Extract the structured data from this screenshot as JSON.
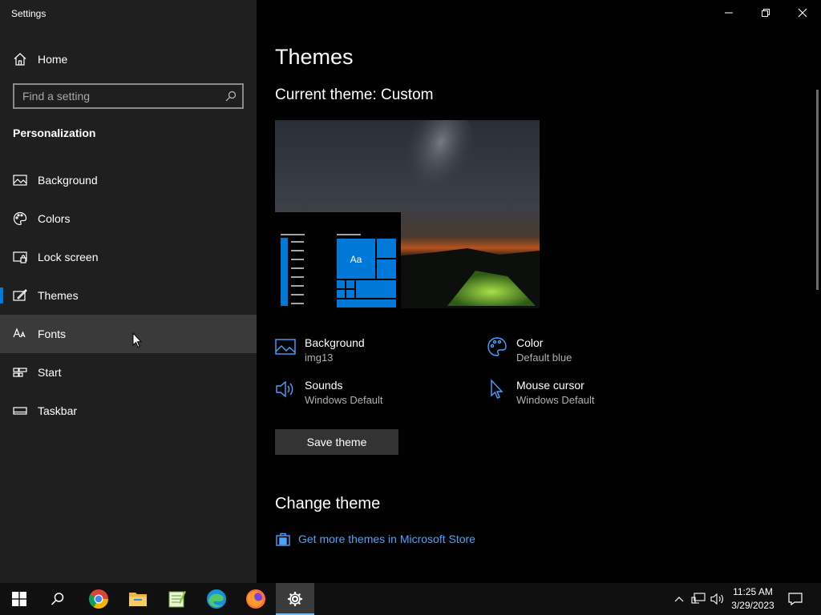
{
  "window": {
    "title": "Settings"
  },
  "sidebar": {
    "home_label": "Home",
    "search_placeholder": "Find a setting",
    "section_title": "Personalization",
    "items": [
      {
        "label": "Background",
        "icon": "picture-icon"
      },
      {
        "label": "Colors",
        "icon": "palette-icon"
      },
      {
        "label": "Lock screen",
        "icon": "lock-screen-icon"
      },
      {
        "label": "Themes",
        "icon": "themes-icon",
        "selected": true
      },
      {
        "label": "Fonts",
        "icon": "fonts-icon",
        "hovered": true
      },
      {
        "label": "Start",
        "icon": "start-icon"
      },
      {
        "label": "Taskbar",
        "icon": "taskbar-icon"
      }
    ]
  },
  "main": {
    "title": "Themes",
    "current_theme": "Current theme: Custom",
    "preview": {
      "tile_text": "Aa"
    },
    "properties": {
      "background": {
        "name": "Background",
        "value": "img13"
      },
      "color": {
        "name": "Color",
        "value": "Default blue"
      },
      "sounds": {
        "name": "Sounds",
        "value": "Windows Default"
      },
      "mouse_cursor": {
        "name": "Mouse cursor",
        "value": "Windows Default"
      }
    },
    "save_button": "Save theme",
    "change_theme_title": "Change theme",
    "store_link": "Get more themes in Microsoft Store"
  },
  "taskbar": {
    "apps": [
      "start-icon",
      "search-icon",
      "chrome-icon",
      "file-explorer-icon",
      "notepad-plus-plus-icon",
      "edge-icon",
      "firefox-icon",
      "settings-icon"
    ],
    "time": "11:25 AM",
    "date": "3/29/2023"
  },
  "colors": {
    "accent": "#0078d7",
    "link": "#4aa3ff",
    "sidebar_bg": "#1f1f1f",
    "main_bg": "#000000"
  }
}
